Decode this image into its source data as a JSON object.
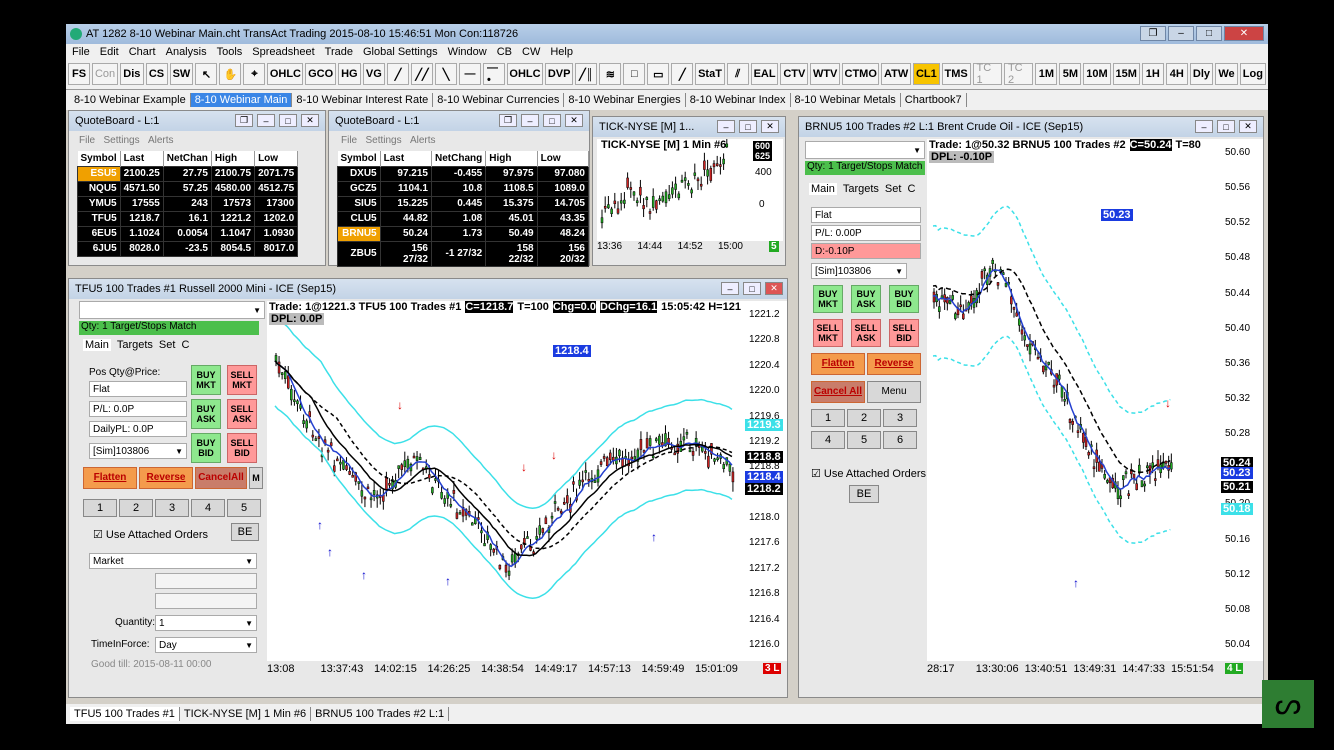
{
  "window": {
    "title": "AT 1282 8-10 Webinar Main.cht  TransAct Trading 2015-08-10  15:46:51 Mon  Con:118726"
  },
  "menu": [
    "File",
    "Edit",
    "Chart",
    "Analysis",
    "Tools",
    "Spreadsheet",
    "Trade",
    "Global Settings",
    "Window",
    "CB",
    "CW",
    "Help"
  ],
  "toolbar": [
    "FS",
    "Con",
    "Dis",
    "CS",
    "SW",
    "OHLC",
    "GCO",
    "HG",
    "VG",
    "OHLC",
    "DVP",
    "StaT",
    "EAL",
    "CTV",
    "WTV",
    "CTMO",
    "ATW",
    "CL1",
    "TMS",
    "TC 1",
    "TC 2",
    "1M",
    "5M",
    "10M",
    "15M",
    "1H",
    "4H",
    "Dly",
    "We",
    "Log"
  ],
  "tabs": [
    "8-10 Webinar Example",
    "8-10 Webinar Main",
    "8-10 Webinar Interest Rate",
    "8-10 Webinar Currencies",
    "8-10 Webinar Energies",
    "8-10 Webinar Index",
    "8-10 Webinar Metals",
    "Chartbook7"
  ],
  "qb1": {
    "title": "QuoteBoard - L:1",
    "menu": [
      "File",
      "Settings",
      "Alerts"
    ],
    "headers": [
      "Symbol",
      "Last",
      "NetChan",
      "High",
      "Low"
    ],
    "rows": [
      [
        "ESU5",
        "2100.25",
        "27.75",
        "2100.75",
        "2071.75"
      ],
      [
        "NQU5",
        "4571.50",
        "57.25",
        "4580.00",
        "4512.75"
      ],
      [
        "YMU5",
        "17555",
        "243",
        "17573",
        "17300"
      ],
      [
        "TFU5",
        "1218.7",
        "16.1",
        "1221.2",
        "1202.0"
      ],
      [
        "6EU5",
        "1.1024",
        "0.0054",
        "1.1047",
        "1.0930"
      ],
      [
        "6JU5",
        "8028.0",
        "-23.5",
        "8054.5",
        "8017.0"
      ]
    ]
  },
  "qb2": {
    "title": "QuoteBoard - L:1",
    "menu": [
      "File",
      "Settings",
      "Alerts"
    ],
    "headers": [
      "Symbol",
      "Last",
      "NetChang",
      "High",
      "Low"
    ],
    "rows": [
      [
        "DXU5",
        "97.215",
        "-0.455",
        "97.975",
        "97.080"
      ],
      [
        "GCZ5",
        "1104.1",
        "10.8",
        "1108.5",
        "1089.0"
      ],
      [
        "SIU5",
        "15.225",
        "0.445",
        "15.375",
        "14.705"
      ],
      [
        "CLU5",
        "44.82",
        "1.08",
        "45.01",
        "43.35"
      ],
      [
        "BRNU5",
        "50.24",
        "1.73",
        "50.49",
        "48.24"
      ],
      [
        "ZBU5",
        "156 27/32",
        "-1 27/32",
        "158 22/32",
        "156 20/32"
      ]
    ]
  },
  "tick": {
    "title": "TICK-NYSE [M] 1...",
    "header": "TICK-NYSE [M]  1 Min  #6",
    "y": [
      "400",
      "0"
    ],
    "x": [
      "13:36",
      "14:44",
      "14:52",
      "15:00"
    ],
    "badge1": "600",
    "badge2": "625",
    "corner": "5"
  },
  "tf": {
    "title": "TFU5  100 Trades  #1  Russell 2000 Mini - ICE (Sep15)",
    "header": "Trade: 1@1221.3  TFU5  100 Trades  #1",
    "c": "C=1218.7",
    "t": "T=100",
    "chg": "Chg=0.0",
    "dchg": "DChg=16.1",
    "time": "15:05:42  H=121",
    "dpl": "DPL: 0.0P",
    "price_lbl": "1218.4",
    "y": [
      "1221.2",
      "1220.8",
      "1220.4",
      "1220.0",
      "1219.6",
      "1219.2",
      "1218.8",
      "1218.4",
      "1218.0",
      "1217.6",
      "1217.2",
      "1216.8",
      "1216.4",
      "1216.0"
    ],
    "x": [
      "13:08",
      "13:37:43",
      "14:02:15",
      "14:26:25",
      "14:38:54",
      "14:49:17",
      "14:57:13",
      "14:59:49",
      "15:01:09"
    ],
    "tags": [
      "1219.3",
      "1218.8",
      "1218.4",
      "1218.2"
    ],
    "corner": "3 L"
  },
  "panel1": {
    "qty": "Qty: 1 Target/Stops Match",
    "tabs": [
      "Main",
      "Targets",
      "Set",
      "C"
    ],
    "pos_lbl": "Pos Qty@Price:",
    "pos": "Flat",
    "pl": "P/L: 0.0P",
    "dpl": "DailyPL: 0.0P",
    "acct": "[Sim]103806",
    "buy_mkt": "BUY MKT",
    "sell_mkt": "SELL MKT",
    "buy_ask": "BUY ASK",
    "sell_ask": "SELL ASK",
    "buy_bid": "BUY BID",
    "sell_bid": "SELL BID",
    "flatten": "Flatten",
    "reverse": "Reverse",
    "cancel": "CancelAll",
    "m": "M",
    "nums": [
      "1",
      "2",
      "3",
      "4",
      "5"
    ],
    "attached": "Use Attached Orders",
    "be": "BE",
    "order_type": "Market",
    "qty_lbl": "Quantity:",
    "qty_val": "1",
    "tif_lbl": "TimeInForce:",
    "tif_val": "Day",
    "good": "Good till: 2015-08-11 00:00"
  },
  "brn": {
    "title": "BRNU5  100 Trades  #2  L:1  Brent Crude Oil - ICE (Sep15)",
    "header": "Trade: 1@50.32  BRNU5  100 Trades  #2",
    "c": "C=50.24",
    "t": "T=80",
    "dpl": "DPL: -0.10P",
    "price_lbl": "50.23",
    "y": [
      "50.60",
      "50.56",
      "50.52",
      "50.48",
      "50.44",
      "50.40",
      "50.36",
      "50.32",
      "50.28",
      "50.24",
      "50.20",
      "50.16",
      "50.12",
      "50.08",
      "50.04"
    ],
    "x": [
      "28:17",
      "13:30:06",
      "13:40:51",
      "13:49:31",
      "14:47:33",
      "15:51:54"
    ],
    "tags": [
      "50.24",
      "50.23",
      "50.21",
      "50.18"
    ],
    "corner": "4 L"
  },
  "panel2": {
    "qty": "Qty: 1 Target/Stops Match",
    "tabs": [
      "Main",
      "Targets",
      "Set",
      "C"
    ],
    "pos": "Flat",
    "pl": "P/L: 0.00P",
    "d": "D:-0.10P",
    "acct": "[Sim]103806",
    "buy_mkt": "BUY MKT",
    "buy_ask": "BUY ASK",
    "buy_bid": "BUY BID",
    "sell_mkt": "SELL MKT",
    "sell_ask": "SELL ASK",
    "sell_bid": "SELL BID",
    "flatten": "Flatten",
    "reverse": "Reverse",
    "cancel": "Cancel All",
    "menu": "Menu",
    "nums": [
      "1",
      "2",
      "3",
      "4",
      "5",
      "6"
    ],
    "attached": "Use Attached Orders",
    "be": "BE"
  },
  "taskbar": [
    "TFU5  100 Trades  #1",
    "TICK-NYSE [M]  1 Min  #6",
    "BRNU5  100 Trades  #2  L:1"
  ]
}
